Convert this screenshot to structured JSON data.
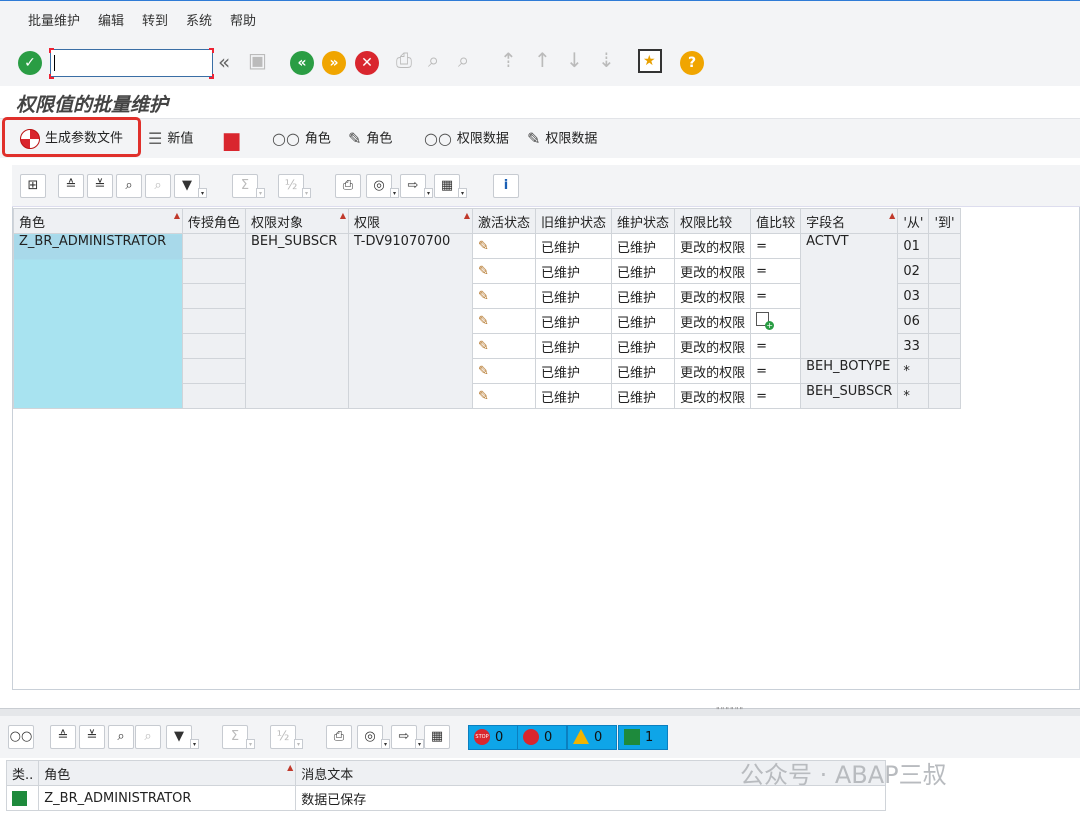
{
  "menu": [
    "批量维护",
    "编辑",
    "转到",
    "系统",
    "帮助"
  ],
  "command_field": {
    "value": ""
  },
  "page_title": "权限值的批量维护",
  "app_toolbar": {
    "generate_param_file": "生成参数文件",
    "new_value": "新值",
    "display_role": "角色",
    "change_role": "角色",
    "display_auth_data": "权限数据",
    "change_auth_data": "权限数据"
  },
  "grid": {
    "headers": [
      "角色",
      "传授角色",
      "权限对象",
      "权限",
      "激活状态",
      "旧维护状态",
      "维护状态",
      "权限比较",
      "值比较",
      "字段名",
      "'从'",
      "'到'"
    ],
    "role": "Z_BR_ADMINISTRATOR",
    "auth_object": "BEH_SUBSCR",
    "authorization": "T-DV91070700",
    "rows": [
      {
        "old_status": "已维护",
        "status": "已维护",
        "auth_compare": "更改的权限",
        "value_compare": "=",
        "field": "ACTVT",
        "from": "01",
        "to": ""
      },
      {
        "old_status": "已维护",
        "status": "已维护",
        "auth_compare": "更改的权限",
        "value_compare": "=",
        "field": "",
        "from": "02",
        "to": ""
      },
      {
        "old_status": "已维护",
        "status": "已维护",
        "auth_compare": "更改的权限",
        "value_compare": "=",
        "field": "",
        "from": "03",
        "to": ""
      },
      {
        "old_status": "已维护",
        "status": "已维护",
        "auth_compare": "更改的权限",
        "value_compare": "add-icon",
        "field": "",
        "from": "06",
        "to": ""
      },
      {
        "old_status": "已维护",
        "status": "已维护",
        "auth_compare": "更改的权限",
        "value_compare": "=",
        "field": "",
        "from": "33",
        "to": ""
      },
      {
        "old_status": "已维护",
        "status": "已维护",
        "auth_compare": "更改的权限",
        "value_compare": "=",
        "field": "BEH_BOTYPE",
        "from": "*",
        "to": ""
      },
      {
        "old_status": "已维护",
        "status": "已维护",
        "auth_compare": "更改的权限",
        "value_compare": "=",
        "field": "BEH_SUBSCR",
        "from": "*",
        "to": ""
      }
    ]
  },
  "counters": {
    "stop": "0",
    "error": "0",
    "warning": "0",
    "success": "1"
  },
  "messages": {
    "headers": [
      "类..",
      "角色",
      "消息文本"
    ],
    "rows": [
      {
        "role": "Z_BR_ADMINISTRATOR",
        "text": "数据已保存"
      }
    ]
  },
  "watermark": "公众号 · ABAP三叔",
  "colors": {
    "selected": "#a8e3f0",
    "highlight_border": "#e0302b",
    "counter_bg": "#0ea5e8"
  }
}
